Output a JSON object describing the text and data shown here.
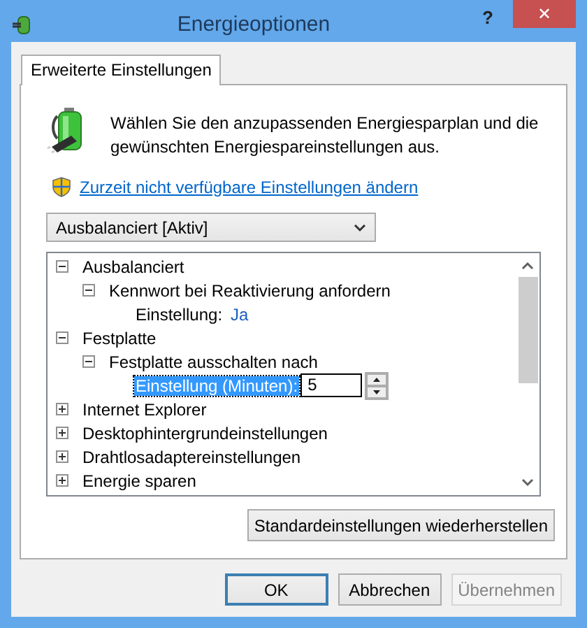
{
  "window": {
    "title": "Energieoptionen",
    "help": "?",
    "close": "✕"
  },
  "tabs": [
    {
      "label": "Erweiterte Einstellungen",
      "selected": true
    }
  ],
  "intro": "Wählen Sie den anzupassenden Energiesparplan und die gewünschten Energiespareinstellungen aus.",
  "link": "Zurzeit nicht verfügbare Einstellungen ändern",
  "plan_dropdown": {
    "value": "Ausbalanciert [Aktiv]"
  },
  "tree": [
    {
      "kind": "group",
      "label": "Ausbalanciert",
      "expanded": true,
      "selected": false,
      "children": [
        {
          "kind": "group",
          "label": "Kennwort bei Reaktivierung anfordern",
          "expanded": true,
          "selected": false,
          "children": [
            {
              "kind": "setting",
              "label": "Einstellung:",
              "value": "Ja",
              "selected": false
            }
          ]
        }
      ]
    },
    {
      "kind": "group",
      "label": "Festplatte",
      "expanded": true,
      "selected": false,
      "children": [
        {
          "kind": "group",
          "label": "Festplatte ausschalten nach",
          "expanded": true,
          "selected": false,
          "children": [
            {
              "kind": "spin",
              "label": "Einstellung (Minuten):",
              "value": "5",
              "selected": true
            }
          ]
        }
      ]
    },
    {
      "kind": "group",
      "label": "Internet Explorer",
      "expanded": false,
      "selected": false
    },
    {
      "kind": "group",
      "label": "Desktophintergrundeinstellungen",
      "expanded": false,
      "selected": false
    },
    {
      "kind": "group",
      "label": "Drahtlosadaptereinstellungen",
      "expanded": false,
      "selected": false
    },
    {
      "kind": "group",
      "label": "Energie sparen",
      "expanded": false,
      "selected": false
    }
  ],
  "restore_button": {
    "label": "Standardeinstellungen wiederherstellen"
  },
  "buttons": [
    {
      "label": "OK",
      "default": true,
      "disabled": false
    },
    {
      "label": "Abbrechen",
      "default": false,
      "disabled": false
    },
    {
      "label": "Übernehmen",
      "default": false,
      "disabled": true
    }
  ]
}
